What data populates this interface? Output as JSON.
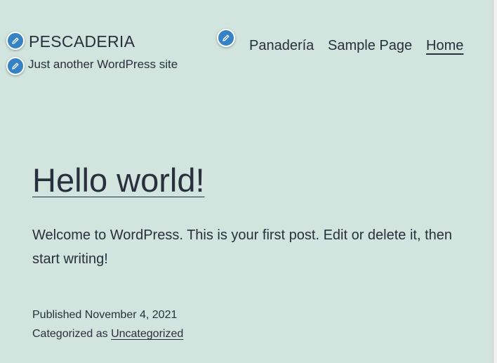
{
  "header": {
    "site_title": "PESCADERIA",
    "tagline": "Just another WordPress site"
  },
  "nav": {
    "items": [
      {
        "label": "Panadería",
        "current": false
      },
      {
        "label": "Sample Page",
        "current": false
      },
      {
        "label": "Home",
        "current": true
      }
    ]
  },
  "post": {
    "title": "Hello world!",
    "body": "Welcome to WordPress. This is your first post. Edit or delete it, then start writing!",
    "published_label": "Published",
    "published_date": "November 4, 2021",
    "categorized_label": "Categorized as",
    "category": "Uncategorized"
  },
  "icons": {
    "edit_shortcut": "pencil-icon"
  },
  "colors": {
    "background": "#d1e4dd",
    "text": "#28303d",
    "edit_shortcut": "#3582c4"
  }
}
